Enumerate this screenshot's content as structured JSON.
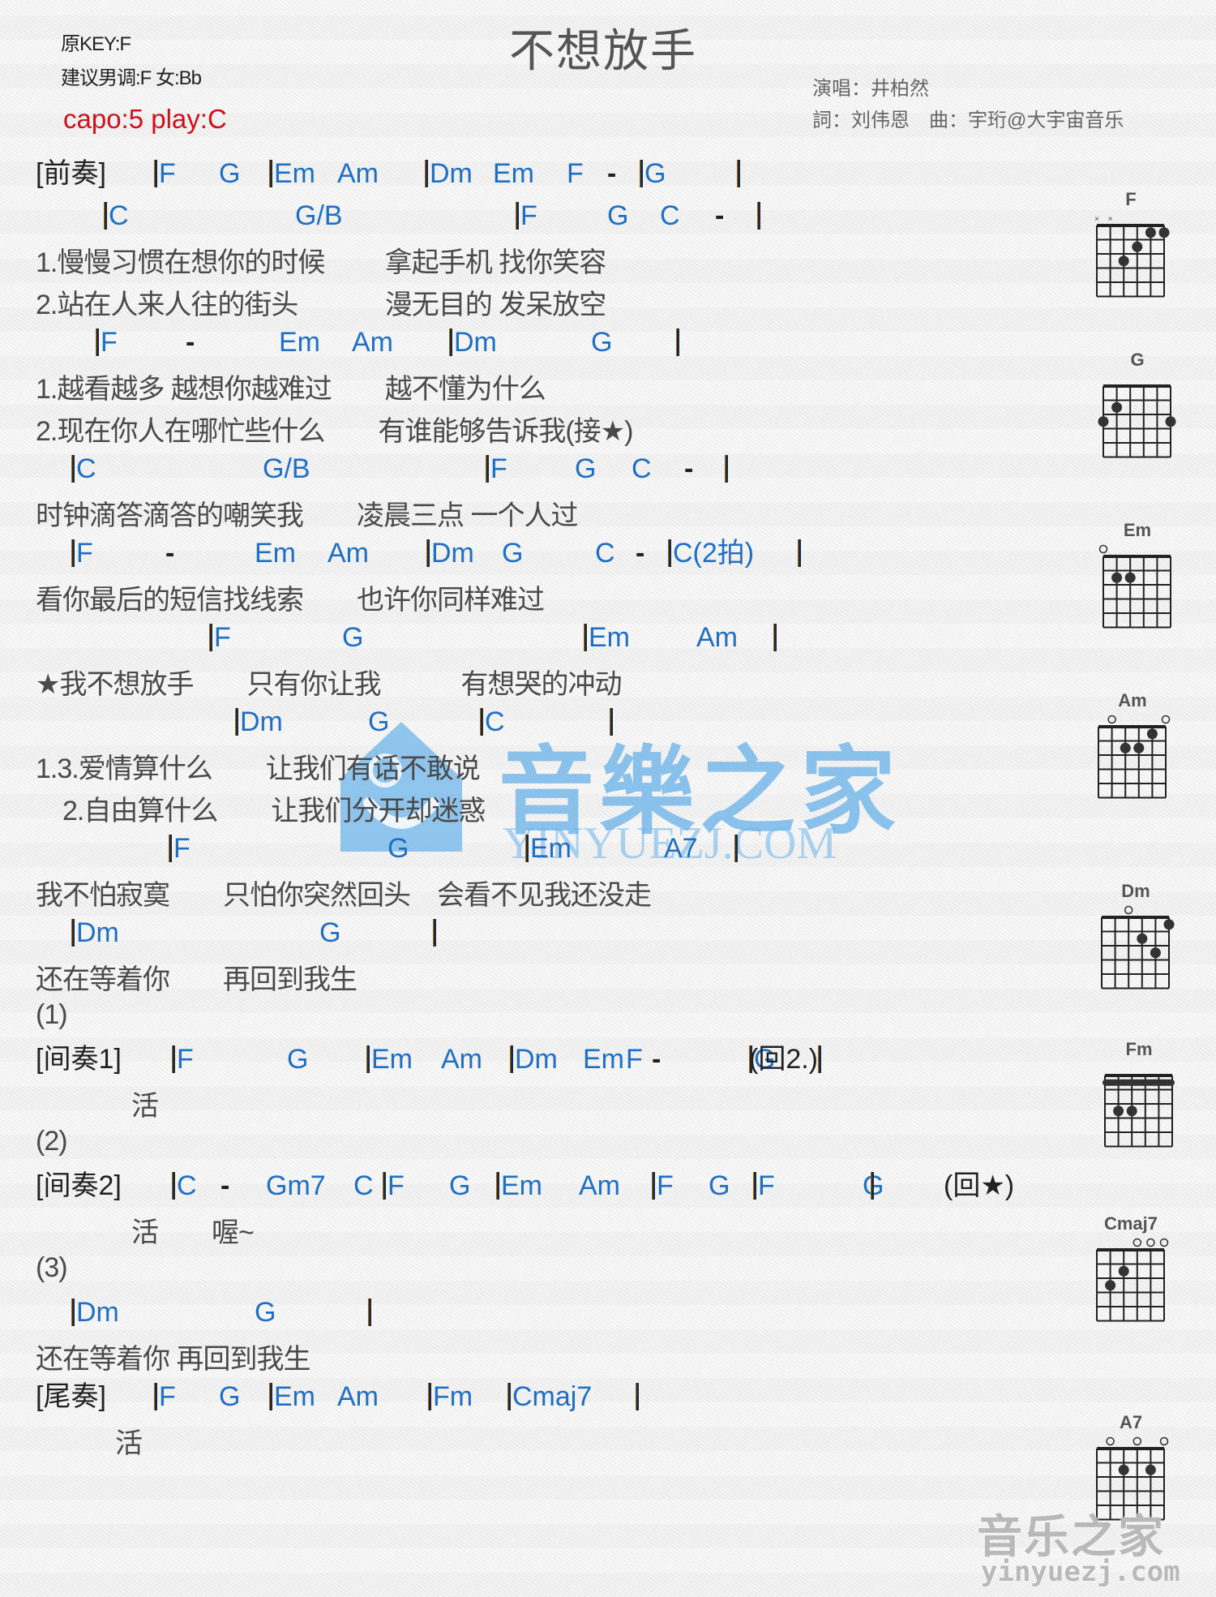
{
  "header": {
    "original_key": "原KEY:F",
    "suggested_key": "建议男调:F 女:Bb",
    "capo": "capo:5 play:C",
    "title": "不想放手",
    "singer": "演唱：井柏然",
    "credits": "詞：刘伟恩　曲：宇珩@大宇宙音乐"
  },
  "colors": {
    "chord": "#1f6fc4",
    "capo": "#d0101a",
    "lyric": "#4a4a4a",
    "bar": "#1a2b44"
  },
  "lines": [
    {
      "type": "chord",
      "tokens": [
        {
          "t": "[前奏]",
          "k": "sec"
        },
        {
          "t": "F",
          "k": "bar"
        },
        {
          "t": "G",
          "k": "chord"
        },
        {
          "t": "Em",
          "k": "bar"
        },
        {
          "t": "Am",
          "k": "chord"
        },
        {
          "t": "Dm",
          "k": "bar"
        },
        {
          "t": "Em",
          "k": "chord"
        },
        {
          "t": "F",
          "k": "chord"
        },
        {
          "t": "-",
          "k": "dash"
        },
        {
          "t": "G",
          "k": "bar"
        },
        {
          "t": "",
          "k": "bar"
        }
      ]
    },
    {
      "type": "chord",
      "tokens": [
        {
          "t": "C",
          "k": "bar"
        },
        {
          "t": "G/B",
          "k": "chord"
        },
        {
          "t": "F",
          "k": "bar"
        },
        {
          "t": "G",
          "k": "chord"
        },
        {
          "t": "C",
          "k": "chord"
        },
        {
          "t": "-",
          "k": "dash"
        },
        {
          "t": "",
          "k": "bar"
        }
      ]
    },
    {
      "type": "lyric",
      "text": "1.慢慢习惯在想你的时候　　 拿起手机 找你笑容"
    },
    {
      "type": "lyric",
      "text": "2.站在人来人往的街头　　　 漫无目的 发呆放空"
    },
    {
      "type": "chord",
      "tokens": [
        {
          "t": "F",
          "k": "bar"
        },
        {
          "t": "-",
          "k": "dash"
        },
        {
          "t": "Em",
          "k": "chord"
        },
        {
          "t": "Am",
          "k": "chord"
        },
        {
          "t": "Dm",
          "k": "bar"
        },
        {
          "t": "G",
          "k": "chord"
        },
        {
          "t": "",
          "k": "bar"
        }
      ]
    },
    {
      "type": "lyric",
      "text": "1.越看越多 越想你越难过　　越不懂为什么"
    },
    {
      "type": "lyric",
      "text": "2.现在你人在哪忙些什么　　有谁能够告诉我(接★)"
    },
    {
      "type": "chord",
      "tokens": [
        {
          "t": "C",
          "k": "bar"
        },
        {
          "t": "G/B",
          "k": "chord"
        },
        {
          "t": "F",
          "k": "bar"
        },
        {
          "t": "G",
          "k": "chord"
        },
        {
          "t": "C",
          "k": "chord"
        },
        {
          "t": "-",
          "k": "dash"
        },
        {
          "t": "",
          "k": "bar"
        }
      ]
    },
    {
      "type": "lyric",
      "text": "时钟滴答滴答的嘲笑我　　凌晨三点 一个人过"
    },
    {
      "type": "chord",
      "tokens": [
        {
          "t": "F",
          "k": "bar"
        },
        {
          "t": "-",
          "k": "dash"
        },
        {
          "t": "Em",
          "k": "chord"
        },
        {
          "t": "Am",
          "k": "chord"
        },
        {
          "t": "Dm",
          "k": "bar"
        },
        {
          "t": "G",
          "k": "chord"
        },
        {
          "t": "C",
          "k": "chord"
        },
        {
          "t": "-",
          "k": "dash"
        },
        {
          "t": "C(2拍)",
          "k": "bar"
        },
        {
          "t": "",
          "k": "bar"
        }
      ]
    },
    {
      "type": "lyric",
      "text": "看你最后的短信找线索　　也许你同样难过"
    },
    {
      "type": "chord",
      "tokens": [
        {
          "t": "F",
          "k": "bar"
        },
        {
          "t": "G",
          "k": "chord"
        },
        {
          "t": "Em",
          "k": "bar"
        },
        {
          "t": "Am",
          "k": "chord"
        },
        {
          "t": "",
          "k": "bar"
        }
      ]
    },
    {
      "type": "lyric",
      "text": "★我不想放手　　只有你让我　　　有想哭的冲动"
    },
    {
      "type": "chord",
      "tokens": [
        {
          "t": "Dm",
          "k": "bar"
        },
        {
          "t": "G",
          "k": "chord"
        },
        {
          "t": "C",
          "k": "bar"
        },
        {
          "t": "",
          "k": "bar"
        }
      ]
    },
    {
      "type": "lyric",
      "text": "1.3.爱情算什么　　让我们有话不敢说"
    },
    {
      "type": "lyric",
      "text": "　2.自由算什么　　让我们分开却迷惑"
    },
    {
      "type": "chord",
      "tokens": [
        {
          "t": "F",
          "k": "bar"
        },
        {
          "t": "G",
          "k": "chord"
        },
        {
          "t": "Em",
          "k": "bar"
        },
        {
          "t": "A7",
          "k": "chord"
        },
        {
          "t": "",
          "k": "bar"
        }
      ]
    },
    {
      "type": "lyric",
      "text": "我不怕寂寞　　只怕你突然回头　会看不见我还没走"
    },
    {
      "type": "chord",
      "tokens": [
        {
          "t": "Dm",
          "k": "bar"
        },
        {
          "t": "G",
          "k": "chord"
        },
        {
          "t": "",
          "k": "bar"
        }
      ]
    },
    {
      "type": "lyric",
      "text": "还在等着你　　再回到我生"
    },
    {
      "type": "lyric",
      "text": "(1)"
    },
    {
      "type": "chord",
      "tokens": [
        {
          "t": "[间奏1]",
          "k": "sec"
        },
        {
          "t": "F",
          "k": "bar"
        },
        {
          "t": "G",
          "k": "chord"
        },
        {
          "t": "Em",
          "k": "bar"
        },
        {
          "t": "Am",
          "k": "chord"
        },
        {
          "t": "Dm",
          "k": "bar"
        },
        {
          "t": "Em",
          "k": "chord"
        },
        {
          "t": "F",
          "k": "chord"
        },
        {
          "t": "-",
          "k": "dash"
        },
        {
          "t": "G",
          "k": "bar"
        },
        {
          "t": "",
          "k": "bar"
        },
        {
          "t": "(回2.)",
          "k": "mark"
        }
      ]
    },
    {
      "type": "lyric",
      "text": "活"
    },
    {
      "type": "lyric",
      "text": "(2)"
    },
    {
      "type": "chord",
      "tokens": [
        {
          "t": "[间奏2]",
          "k": "sec"
        },
        {
          "t": "C",
          "k": "bar"
        },
        {
          "t": "-",
          "k": "dash"
        },
        {
          "t": "Gm7",
          "k": "chord"
        },
        {
          "t": "C",
          "k": "chord"
        },
        {
          "t": "F",
          "k": "bar"
        },
        {
          "t": "G",
          "k": "chord"
        },
        {
          "t": "Em",
          "k": "bar"
        },
        {
          "t": "Am",
          "k": "chord"
        },
        {
          "t": "F",
          "k": "bar"
        },
        {
          "t": "G",
          "k": "chord"
        },
        {
          "t": "F",
          "k": "bar"
        },
        {
          "t": "G",
          "k": "chord"
        },
        {
          "t": "",
          "k": "bar"
        },
        {
          "t": "(回★)",
          "k": "mark"
        }
      ]
    },
    {
      "type": "lyric",
      "text": "活　　喔~"
    },
    {
      "type": "lyric",
      "text": "(3)"
    },
    {
      "type": "chord",
      "tokens": [
        {
          "t": "Dm",
          "k": "bar"
        },
        {
          "t": "G",
          "k": "chord"
        },
        {
          "t": "",
          "k": "bar"
        }
      ]
    },
    {
      "type": "lyric",
      "text": "还在等着你 再回到我生"
    },
    {
      "type": "chord",
      "tokens": [
        {
          "t": "[尾奏]",
          "k": "sec"
        },
        {
          "t": "F",
          "k": "bar"
        },
        {
          "t": "G",
          "k": "chord"
        },
        {
          "t": "Em",
          "k": "bar"
        },
        {
          "t": "Am",
          "k": "chord"
        },
        {
          "t": "Fm",
          "k": "bar"
        },
        {
          "t": "Cmaj7",
          "k": "bar"
        },
        {
          "t": "",
          "k": "bar"
        }
      ]
    },
    {
      "type": "lyric",
      "text": "活"
    }
  ],
  "chord_diagrams": [
    {
      "name": "F",
      "top": [
        "x",
        "x",
        "",
        "",
        "",
        ""
      ],
      "dots": [
        [
          5,
          1
        ],
        [
          6,
          1
        ],
        [
          4,
          2
        ],
        [
          3,
          3
        ]
      ],
      "barre": null
    },
    {
      "name": "G",
      "top": [
        "",
        "",
        "",
        "",
        "",
        ""
      ],
      "dots": [
        [
          2,
          2
        ],
        [
          1,
          3
        ],
        [
          6,
          3
        ]
      ],
      "barre": null
    },
    {
      "name": "Em",
      "top": [
        "o",
        "",
        "",
        "",
        "",
        ""
      ],
      "dots": [
        [
          2,
          2
        ],
        [
          3,
          2
        ]
      ],
      "barre": null
    },
    {
      "name": "Am",
      "top": [
        "",
        "o",
        "",
        "",
        "",
        "o"
      ],
      "dots": [
        [
          5,
          1
        ],
        [
          3,
          2
        ],
        [
          4,
          2
        ]
      ],
      "barre": null
    },
    {
      "name": "Dm",
      "top": [
        "",
        "",
        "o",
        "",
        "",
        ""
      ],
      "dots": [
        [
          6,
          1
        ],
        [
          4,
          2
        ],
        [
          5,
          3
        ]
      ],
      "barre": null
    },
    {
      "name": "Fm",
      "top": [
        "",
        "",
        "",
        "",
        "",
        ""
      ],
      "dots": [
        [
          2,
          3
        ],
        [
          3,
          3
        ]
      ],
      "barre": 1
    },
    {
      "name": "Cmaj7",
      "top": [
        "",
        "",
        "",
        "o",
        "o",
        "o"
      ],
      "dots": [
        [
          3,
          2
        ],
        [
          2,
          3
        ]
      ],
      "barre": null
    },
    {
      "name": "A7",
      "top": [
        "",
        "o",
        "",
        "o",
        "",
        "o"
      ],
      "dots": [
        [
          3,
          2
        ],
        [
          5,
          2
        ]
      ],
      "barre": null
    }
  ],
  "watermarks": {
    "center_cn": "音樂之家",
    "center_en": "YINYUEZJ.COM",
    "corner_cn": "音乐之家",
    "corner_en": "yinyuezj.com"
  }
}
